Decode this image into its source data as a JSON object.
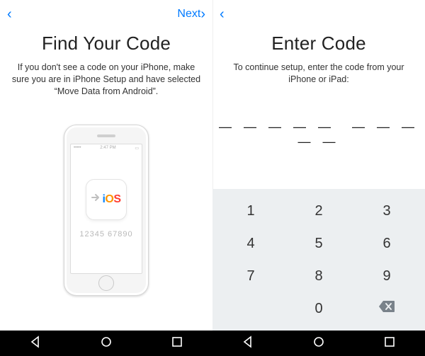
{
  "left": {
    "next_label": "Next",
    "title": "Find Your Code",
    "description": "If you don't see a code on your iPhone, make sure you are in iPhone Setup and have selected “Move Data from Android”.",
    "sample_code": "12345 67890",
    "status_time": "2:47 PM"
  },
  "right": {
    "title": "Enter Code",
    "description": "To continue setup, enter the code from your iPhone or iPad:",
    "dashes": "— — — — — — — — — —",
    "keys": [
      "1",
      "2",
      "3",
      "4",
      "5",
      "6",
      "7",
      "8",
      "9",
      "",
      "0",
      ""
    ]
  }
}
